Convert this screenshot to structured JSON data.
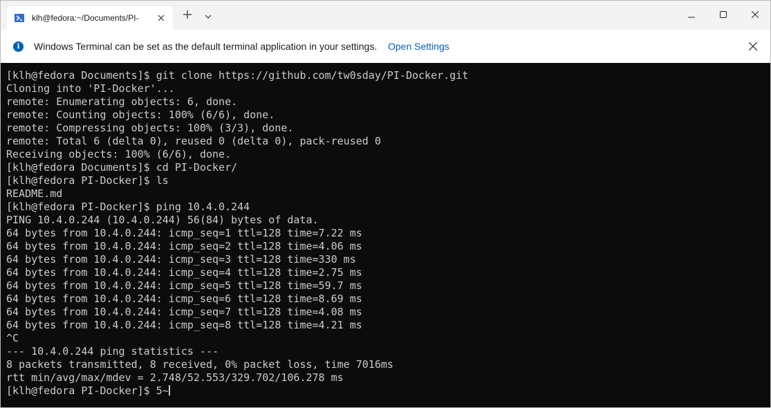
{
  "tab": {
    "title": "klh@fedora:~/Documents/PI-",
    "icon": "powershell-terminal-icon"
  },
  "titlebar": {
    "new_tab_icon": "plus-icon",
    "dropdown_icon": "chevron-down-icon",
    "minimize_icon": "minimize-icon",
    "maximize_icon": "maximize-icon",
    "close_icon": "close-icon"
  },
  "infobar": {
    "message": "Windows Terminal can be set as the default terminal application in your settings.",
    "link": "Open Settings",
    "accent": "#005fb8"
  },
  "terminal": {
    "lines": [
      "[klh@fedora Documents]$ git clone https://github.com/tw0sday/PI-Docker.git",
      "Cloning into 'PI-Docker'...",
      "remote: Enumerating objects: 6, done.",
      "remote: Counting objects: 100% (6/6), done.",
      "remote: Compressing objects: 100% (3/3), done.",
      "remote: Total 6 (delta 0), reused 0 (delta 0), pack-reused 0",
      "Receiving objects: 100% (6/6), done.",
      "[klh@fedora Documents]$ cd PI-Docker/",
      "[klh@fedora PI-Docker]$ ls",
      "README.md",
      "[klh@fedora PI-Docker]$ ping 10.4.0.244",
      "PING 10.4.0.244 (10.4.0.244) 56(84) bytes of data.",
      "64 bytes from 10.4.0.244: icmp_seq=1 ttl=128 time=7.22 ms",
      "64 bytes from 10.4.0.244: icmp_seq=2 ttl=128 time=4.06 ms",
      "64 bytes from 10.4.0.244: icmp_seq=3 ttl=128 time=330 ms",
      "64 bytes from 10.4.0.244: icmp_seq=4 ttl=128 time=2.75 ms",
      "64 bytes from 10.4.0.244: icmp_seq=5 ttl=128 time=59.7 ms",
      "64 bytes from 10.4.0.244: icmp_seq=6 ttl=128 time=8.69 ms",
      "64 bytes from 10.4.0.244: icmp_seq=7 ttl=128 time=4.08 ms",
      "64 bytes from 10.4.0.244: icmp_seq=8 ttl=128 time=4.21 ms",
      "^C",
      "--- 10.4.0.244 ping statistics ---",
      "8 packets transmitted, 8 received, 0% packet loss, time 7016ms",
      "rtt min/avg/max/mdev = 2.748/52.553/329.702/106.278 ms"
    ],
    "prompt": "[klh@fedora PI-Docker]$ ",
    "input": "5~",
    "foreground": "#cccccc",
    "background": "#0c0c0c"
  }
}
